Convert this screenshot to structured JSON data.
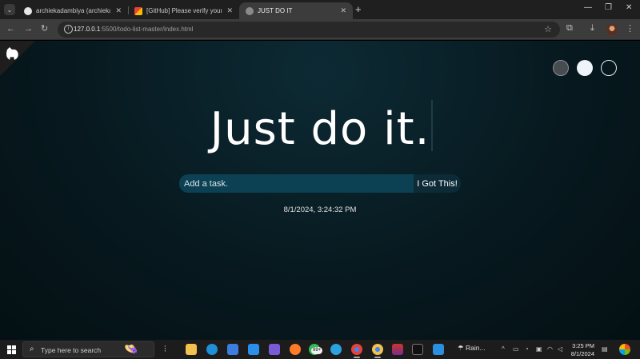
{
  "browser": {
    "tabs": [
      {
        "title": "archiekadambiya (archiekadambiya)",
        "favicon": "github-icon",
        "active": false
      },
      {
        "title": "[GitHub] Please verify your device",
        "favicon": "gmail-icon",
        "active": false
      },
      {
        "title": "JUST DO IT",
        "favicon": "globe-icon",
        "active": true
      }
    ],
    "url_host": "127.0.0.1",
    "url_path": ":5500/todo-list-master/index.html"
  },
  "page": {
    "heading": "Just do it.",
    "task_placeholder": "Add a task.",
    "submit_label": "I Got This!",
    "datetime": "8/1/2024, 3:24:32 PM",
    "theme_colors": [
      "#464c4f",
      "#eef4f7",
      "transparent"
    ]
  },
  "taskbar": {
    "search_placeholder": "Type here to search",
    "whatsapp_badge": "99+",
    "weather": "Rain...",
    "time": "3:25 PM",
    "date": "8/1/2024"
  }
}
